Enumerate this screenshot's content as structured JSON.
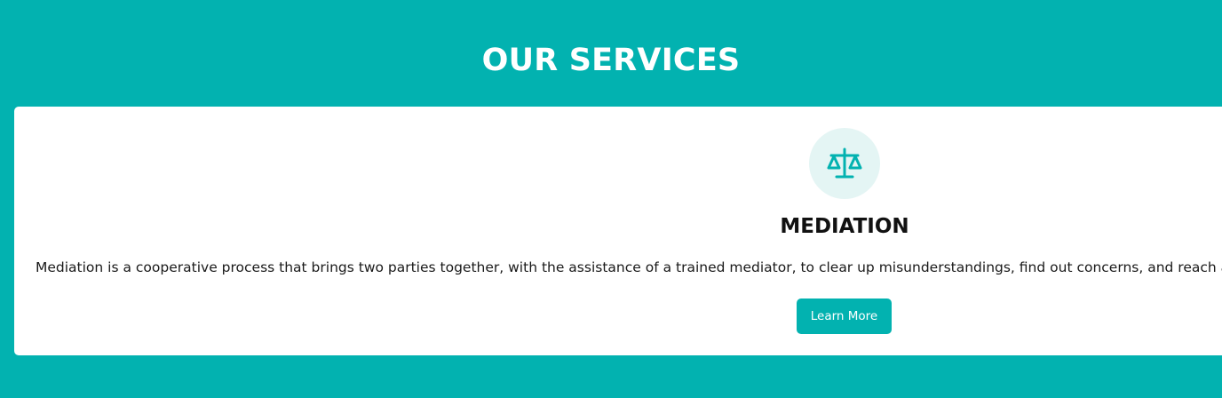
{
  "section": {
    "title": "OUR SERVICES"
  },
  "service": {
    "icon": "scale-icon",
    "title": "MEDIATION",
    "description": "Mediation is a cooperative process that brings two parties together, with the assistance of a trained mediator, to clear up misunderstandings, find out concerns, and reach a coop",
    "button_label": "Learn More"
  },
  "colors": {
    "brand": "#02b2b0",
    "icon_background": "#e4f5f4",
    "card": "#ffffff"
  }
}
